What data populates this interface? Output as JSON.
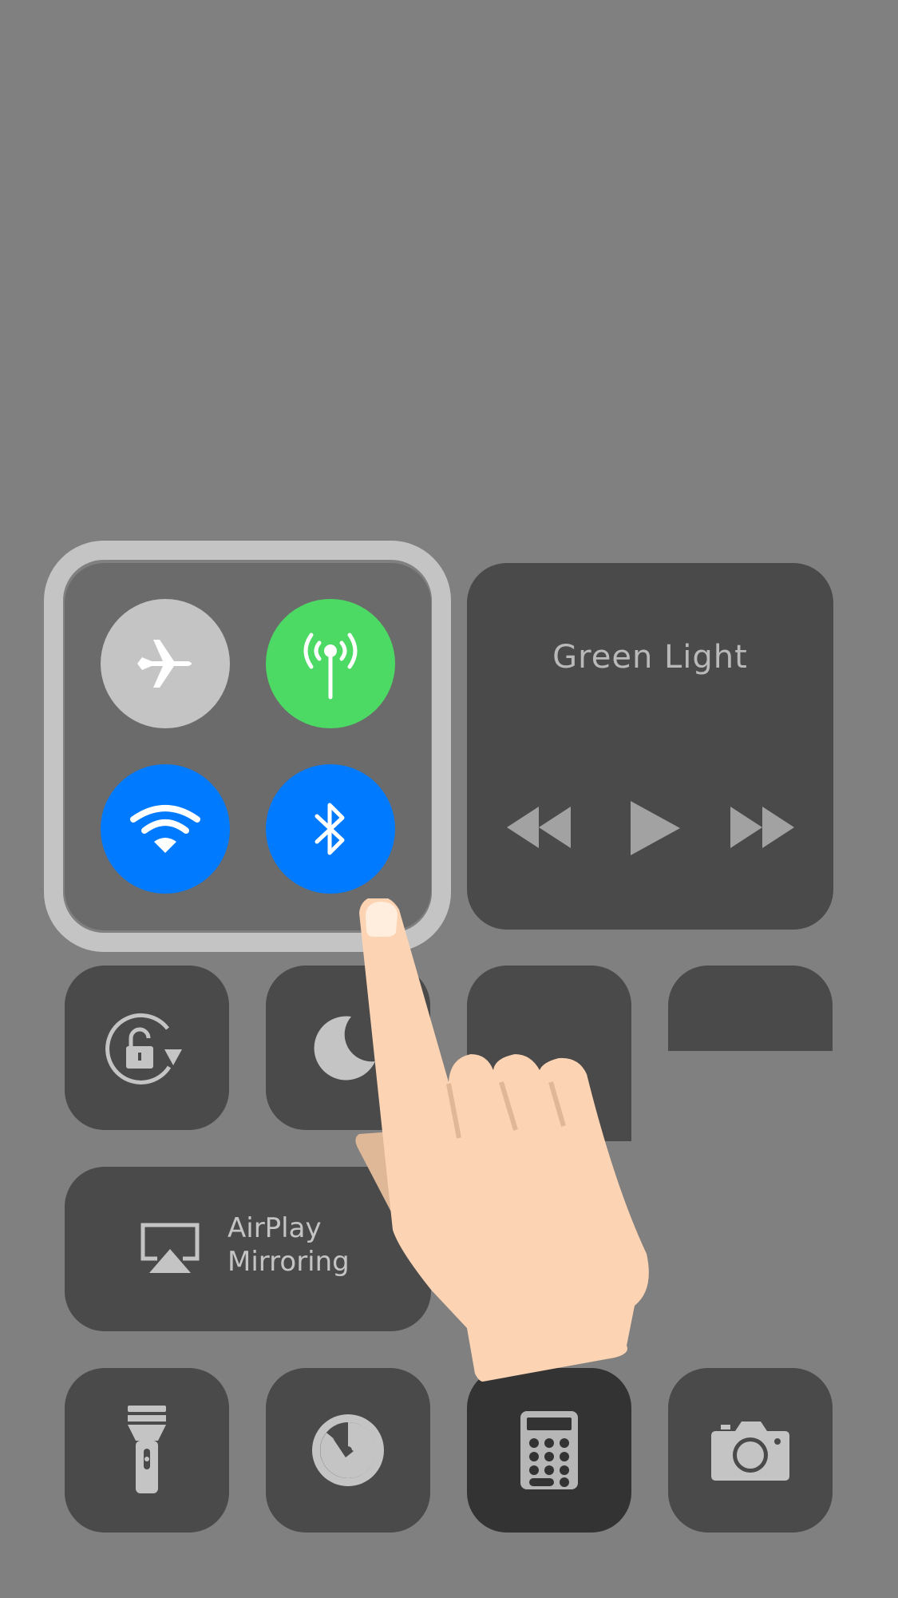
{
  "background_color": "#808080",
  "connectivity": {
    "airplane_mode": {
      "icon": "airplane-icon",
      "state": "off",
      "color": "#c4c4c4"
    },
    "cellular_data": {
      "icon": "antenna-icon",
      "state": "on",
      "color": "#4cd964"
    },
    "wifi": {
      "icon": "wifi-icon",
      "state": "on",
      "color": "#007aff"
    },
    "bluetooth": {
      "icon": "bluetooth-icon",
      "state": "on",
      "color": "#007aff"
    }
  },
  "media": {
    "title": "Green Light",
    "controls": [
      "rewind-icon",
      "play-icon",
      "fast-forward-icon"
    ]
  },
  "controls": {
    "orientation_lock": {
      "icon": "rotation-lock-icon"
    },
    "do_not_disturb": {
      "icon": "moon-icon"
    },
    "airplay": {
      "icon": "airplay-icon",
      "label_line1": "AirPlay",
      "label_line2": "Mirroring"
    },
    "flashlight": {
      "icon": "flashlight-icon"
    },
    "timer": {
      "icon": "timer-icon"
    },
    "calculator": {
      "icon": "calculator-icon",
      "state": "pressed"
    },
    "camera": {
      "icon": "camera-icon"
    }
  },
  "overlay": {
    "icon": "pointing-hand-icon"
  }
}
